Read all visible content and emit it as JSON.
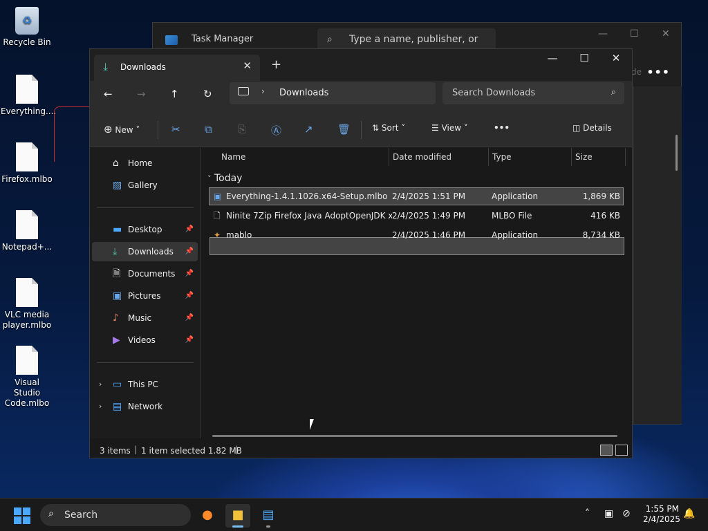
{
  "desktop": {
    "icons": [
      {
        "label": "Recycle Bin"
      },
      {
        "label": "Everything...."
      },
      {
        "label": "Firefox.mlbo"
      },
      {
        "label": "Notepad+..."
      },
      {
        "label": "VLC media player.mlbo"
      },
      {
        "label": "Visual Studio Code.mlbo"
      }
    ]
  },
  "taskmanager": {
    "title": "Task Manager",
    "search_placeholder": "Type a name, publisher, or PID...",
    "partial_label": "de"
  },
  "explorer": {
    "tab_title": "Downloads",
    "address": "Downloads",
    "search_placeholder": "Search Downloads",
    "commands": {
      "new": "New",
      "sort": "Sort",
      "view": "View",
      "details": "Details"
    },
    "nav": {
      "home": "Home",
      "gallery": "Gallery",
      "desktop": "Desktop",
      "downloads": "Downloads",
      "documents": "Documents",
      "pictures": "Pictures",
      "music": "Music",
      "videos": "Videos",
      "thispc": "This PC",
      "network": "Network"
    },
    "columns": {
      "name": "Name",
      "date": "Date modified",
      "type": "Type",
      "size": "Size"
    },
    "group": "Today",
    "files": [
      {
        "name": "Everything-1.4.1.1026.x64-Setup.mlbo",
        "date": "2/4/2025 1:51 PM",
        "type": "Application",
        "size": "1,869 KB"
      },
      {
        "name": "Ninite 7Zip Firefox Java AdoptOpenJDK x...",
        "date": "2/4/2025 1:49 PM",
        "type": "MLBO File",
        "size": "416 KB"
      },
      {
        "name": "mablo",
        "date": "2/4/2025 1:46 PM",
        "type": "Application",
        "size": "8,734 KB"
      }
    ],
    "status": {
      "items": "3 items",
      "selected": "1 item selected  1.82 MB"
    }
  },
  "taskbar": {
    "search_label": "Search",
    "time": "1:55 PM",
    "date": "2/4/2025"
  }
}
